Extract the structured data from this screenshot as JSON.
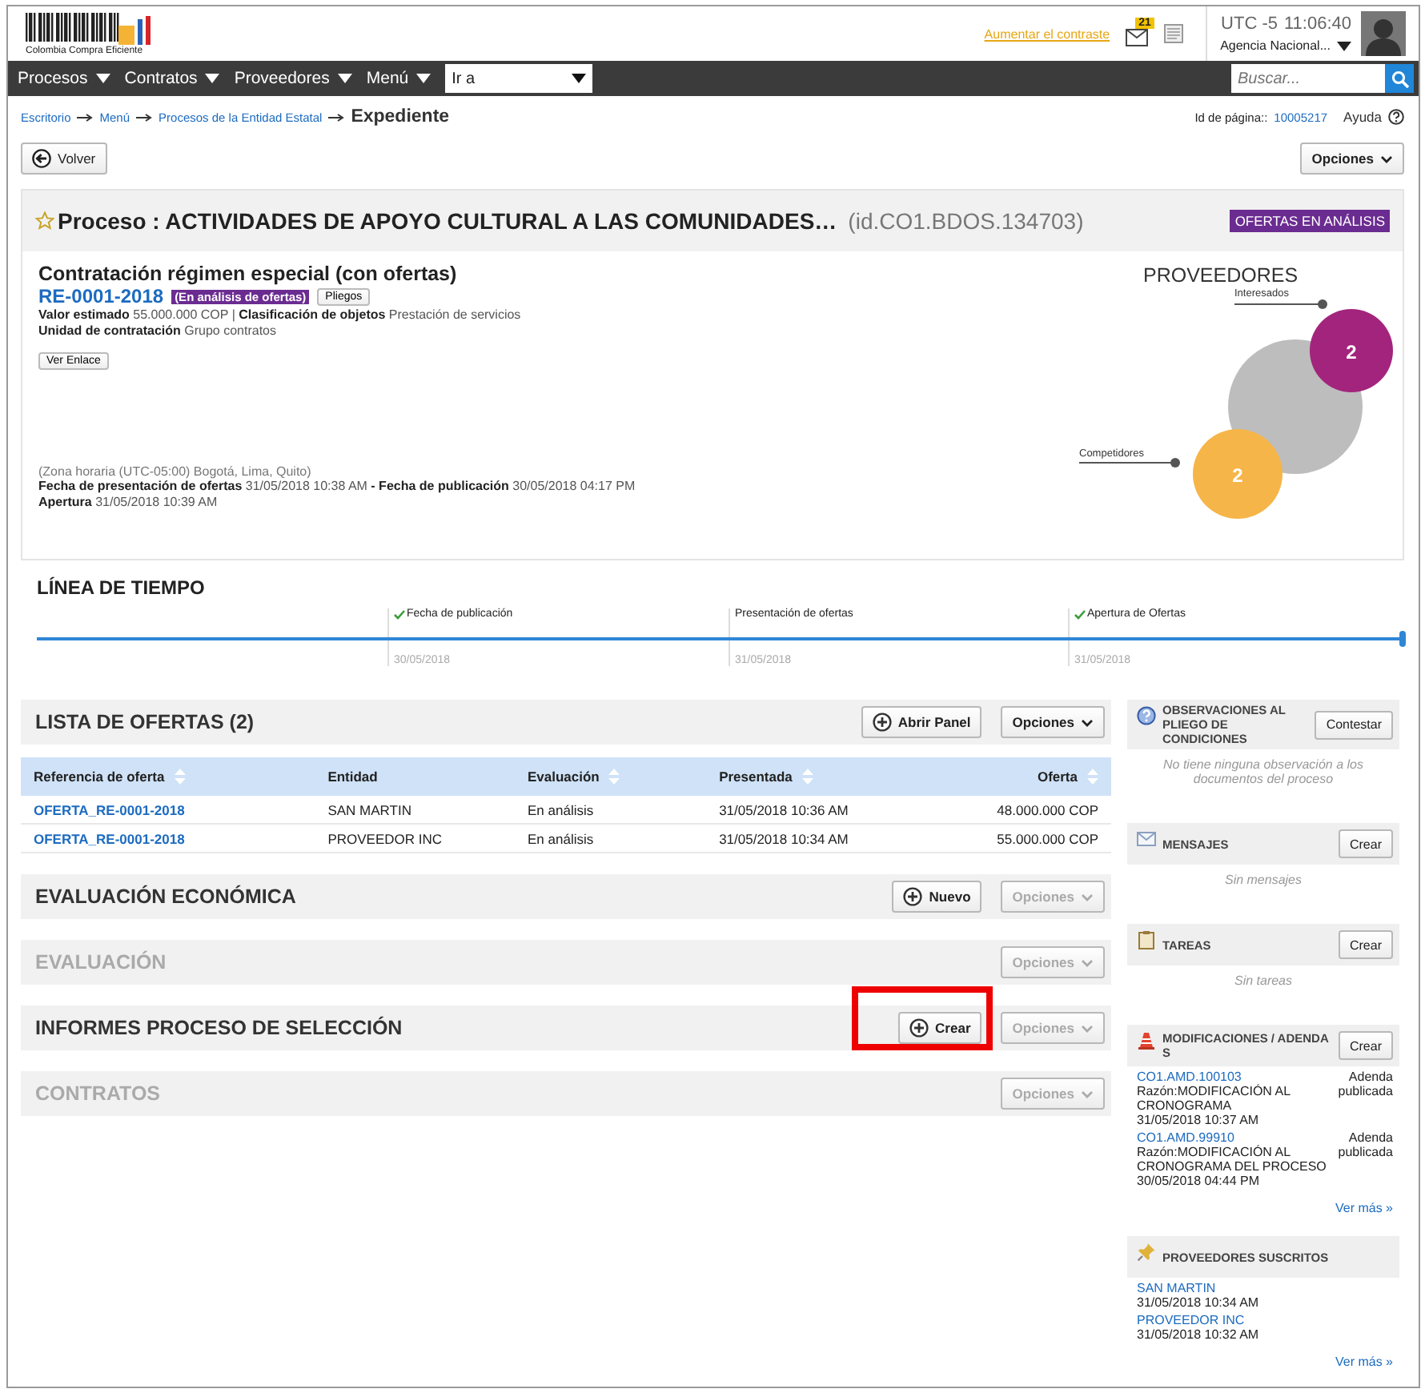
{
  "header": {
    "logo_text": "Colombia Compra Eficiente",
    "contrast_link": "Aumentar el contraste",
    "mail_badge": "21",
    "timezone": "UTC -5",
    "time": "11:06:40",
    "agency": "Agencia Nacional..."
  },
  "nav": {
    "items": [
      "Procesos",
      "Contratos",
      "Proveedores",
      "Menú"
    ],
    "goto": "Ir a",
    "search_placeholder": "Buscar..."
  },
  "breadcrumb": {
    "items": [
      "Escritorio",
      "Menú",
      "Procesos de la Entidad Estatal"
    ],
    "current": "Expediente"
  },
  "page_id": {
    "label": "Id de página::",
    "value": "10005217"
  },
  "help": "Ayuda",
  "back_button": "Volver",
  "options_button": "Opciones",
  "process": {
    "title": "Proceso : ACTIVIDADES DE APOYO CULTURAL A LAS COMUNIDADES…",
    "id": "(id.CO1.BDOS.134703)",
    "status": "OFERTAS EN ANÁLISIS",
    "type": "Contratación régimen especial (con ofertas)",
    "reference": "RE-0001-2018",
    "stage": "(En análisis de ofertas)",
    "pliegos_button": "Pliegos",
    "details": [
      "**Valor estimado** 55.000.000 COP | **Clasificación de objetos**  Prestación de servicios",
      "**Unidad de contratación** Grupo contratos"
    ],
    "link_button": "Ver Enlace",
    "timezone": "(Zona horaria (UTC-05:00) Bogotá, Lima, Quito)",
    "dates": [
      "**Fecha de presentación de ofertas** 31/05/2018 10:38 AM **- Fecha de publicación** 30/05/2018 04:17 PM",
      "**Apertura** 31/05/2018 10:39 AM"
    ]
  },
  "providers": {
    "title": "PROVEEDORES",
    "interested_label": "Interesados",
    "interested_count": "2",
    "competitors_label": "Competidores",
    "competitors_count": "2"
  },
  "timeline": {
    "title": "LÍNEA DE TIEMPO",
    "events": [
      {
        "label": "Fecha de publicación",
        "date": "30/05/2018",
        "done": true
      },
      {
        "label": "Presentación de ofertas",
        "date": "31/05/2018",
        "done": false
      },
      {
        "label": "Apertura de Ofertas",
        "date": "31/05/2018",
        "done": true
      }
    ]
  },
  "offers": {
    "title": "LISTA DE OFERTAS (2)",
    "panel_button": "Abrir Panel",
    "options_button": "Opciones",
    "columns": [
      {
        "label": "Referencia de oferta",
        "sortable": true
      },
      {
        "label": "Entidad",
        "sortable": false
      },
      {
        "label": "Evaluación",
        "sortable": true
      },
      {
        "label": "Presentada",
        "sortable": true
      },
      {
        "label": "Oferta",
        "sortable": true
      }
    ],
    "rows": [
      [
        "OFERTA_RE-0001-2018",
        "SAN MARTIN",
        "En análisis",
        "31/05/2018 10:36 AM",
        "48.000.000 COP"
      ],
      [
        "OFERTA_RE-0001-2018",
        "PROVEEDOR INC",
        "En análisis",
        "31/05/2018 10:34 AM",
        "55.000.000 COP"
      ]
    ]
  },
  "sections": [
    {
      "title": "EVALUACIÓN ECONÓMICA",
      "disabled": false,
      "action": "Nuevo",
      "highlighted": false,
      "options": "Opciones",
      "options_disabled": true
    },
    {
      "title": "EVALUACIÓN",
      "disabled": true,
      "options": "Opciones",
      "options_disabled": true
    },
    {
      "title": "INFORMES PROCESO DE SELECCIÓN",
      "disabled": false,
      "action": "Crear",
      "highlighted": true,
      "options": "Opciones",
      "options_disabled": true
    },
    {
      "title": "CONTRATOS",
      "disabled": true,
      "options": "Opciones",
      "options_disabled": true
    }
  ],
  "sidebar": [
    {
      "kind": "question",
      "title": "OBSERVACIONES AL PLIEGO DE CONDICIONES",
      "button": "Contestar",
      "empty": "No tiene ninguna observación a los documentos del proceso"
    },
    {
      "kind": "mail",
      "title": "MENSAJES",
      "button": "Crear",
      "empty": "Sin mensajes"
    },
    {
      "kind": "clipboard",
      "title": "TAREAS",
      "button": "Crear",
      "empty": "Sin tareas"
    },
    {
      "kind": "cone",
      "title": "MODIFICACIONES / ADENDAS",
      "button": "Crear",
      "entries": [
        {
          "link": "CO1.AMD.100103",
          "reason": "Razón:MODIFICACIÓN AL CRONOGRAMA",
          "date": "31/05/2018 10:37 AM",
          "status": "Adenda publicada"
        },
        {
          "link": "CO1.AMD.99910",
          "reason": "Razón:MODIFICACIÓN AL CRONOGRAMA DEL PROCESO",
          "date": "30/05/2018 04:44 PM",
          "status": "Adenda publicada"
        }
      ],
      "more": "Ver más »"
    },
    {
      "kind": "pin",
      "title": "PROVEEDORES SUSCRITOS",
      "entries": [
        {
          "link": "SAN MARTIN",
          "date": "31/05/2018 10:34 AM"
        },
        {
          "link": "PROVEEDOR INC",
          "date": "31/05/2018 10:32 AM"
        }
      ],
      "more": "Ver más »"
    }
  ]
}
